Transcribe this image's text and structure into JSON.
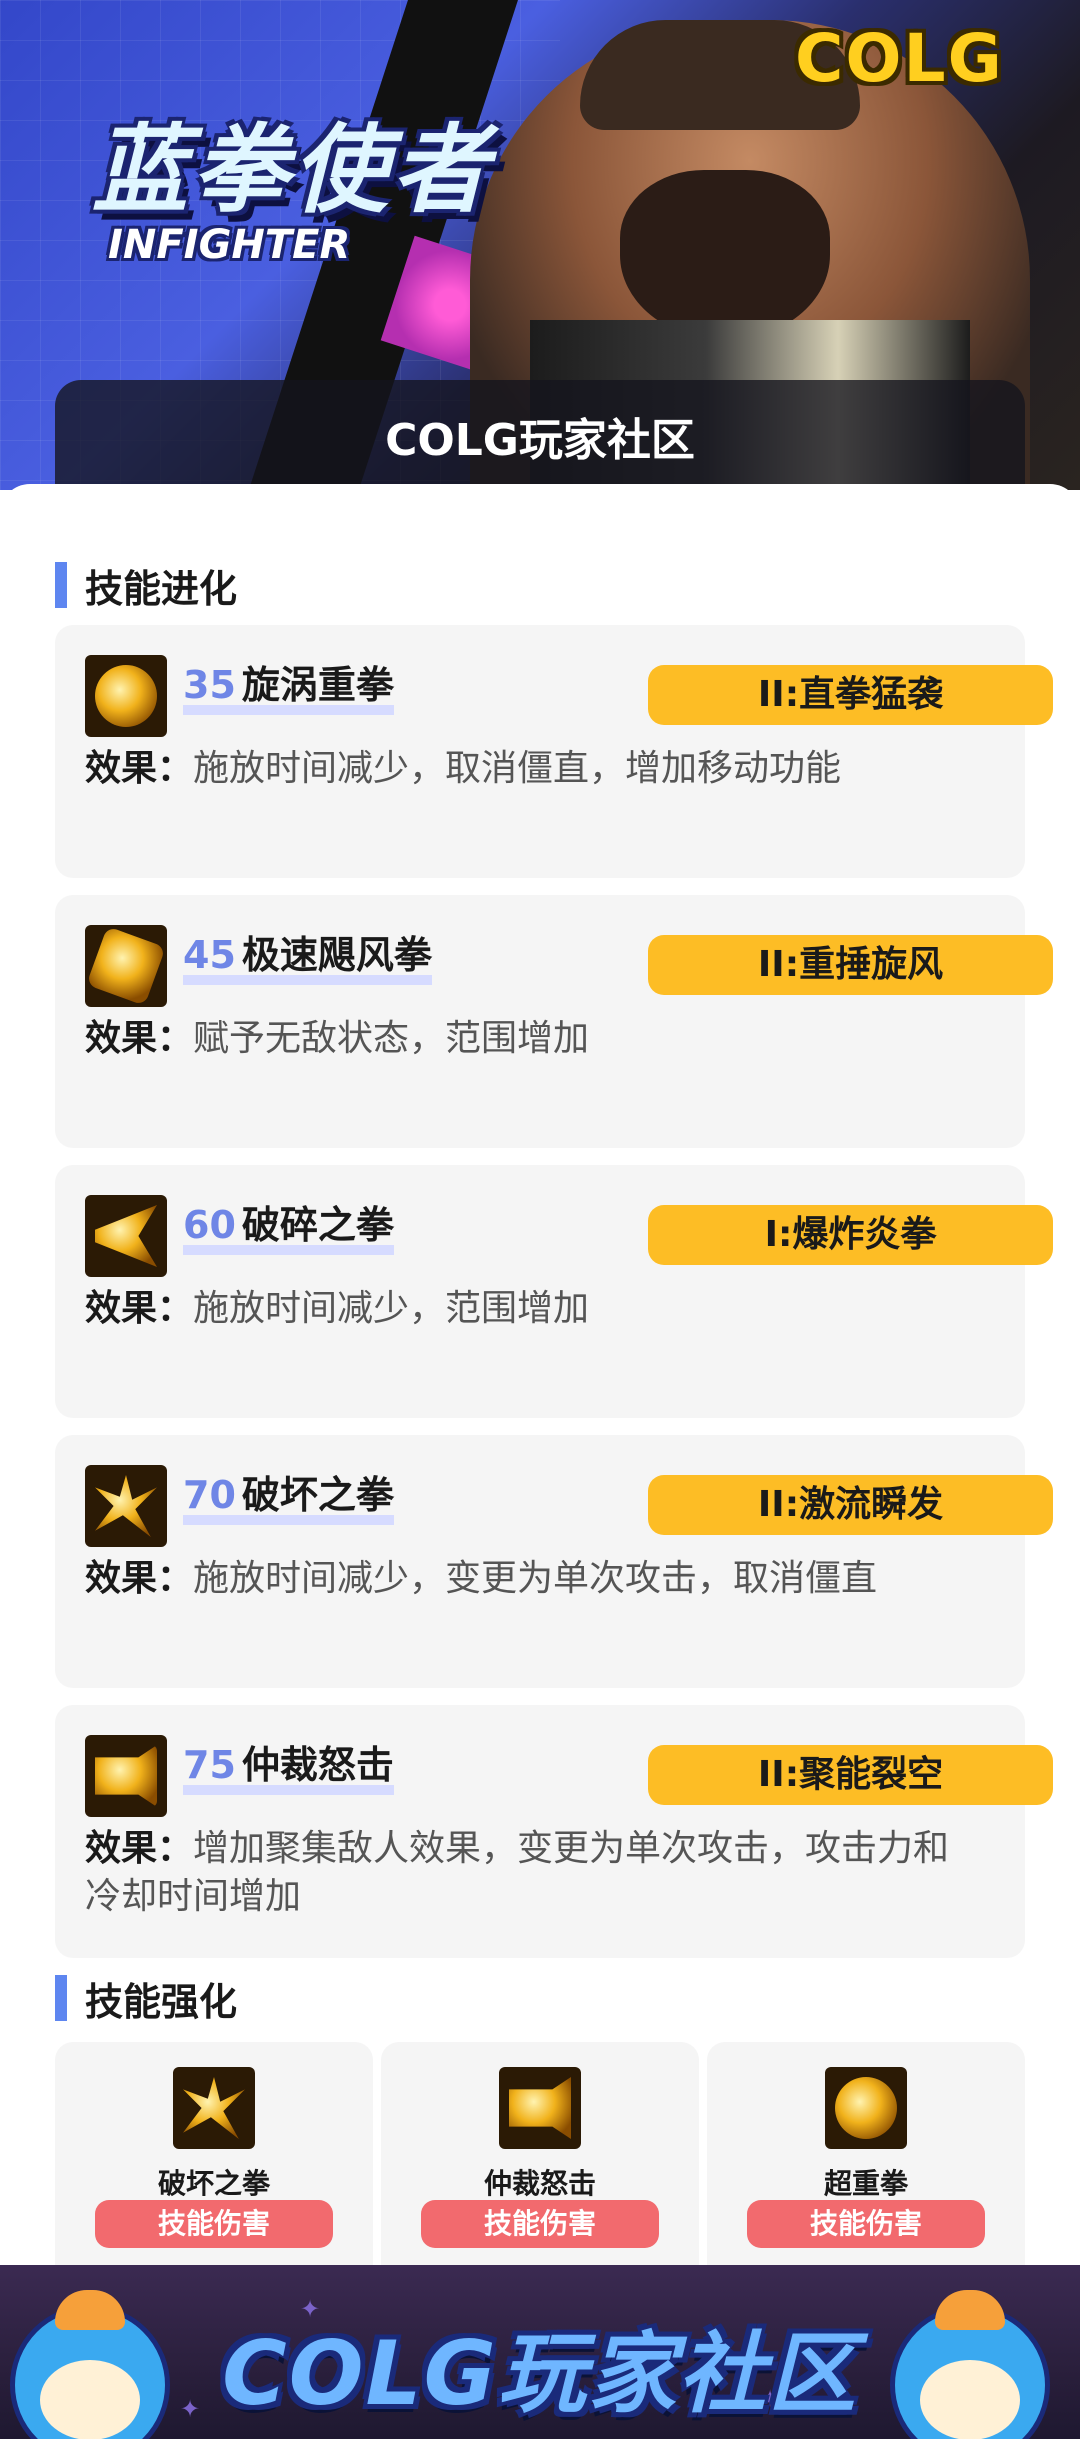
{
  "header": {
    "hero_title": "蓝拳使者",
    "hero_subtitle": "INFIGHTER",
    "brand_logo": "COLG",
    "community_label": "COLG玩家社区"
  },
  "sections": {
    "evolution_title": "技能进化",
    "enhance_title": "技能强化"
  },
  "effect_prefix": "效果：",
  "skills": [
    {
      "level": "35",
      "name": "旋涡重拳",
      "badge": "ⅠⅠ:直拳猛袭",
      "effect": "施放时间减少，取消僵直，增加移动功能",
      "icon": "vortex-punch-icon"
    },
    {
      "level": "45",
      "name": "极速飓风拳",
      "badge": "ⅠⅠ:重捶旋风",
      "effect": "赋予无敌状态，范围增加",
      "icon": "hurricane-punch-icon"
    },
    {
      "level": "60",
      "name": "破碎之拳",
      "badge": "Ⅰ:爆炸炎拳",
      "effect": "施放时间减少，范围增加",
      "icon": "shatter-fist-icon"
    },
    {
      "level": "70",
      "name": "破坏之拳",
      "badge": "ⅠⅠ:激流瞬发",
      "effect": "施放时间减少，变更为单次攻击，取消僵直",
      "icon": "destruction-fist-icon"
    },
    {
      "level": "75",
      "name": "仲裁怒击",
      "badge": "ⅠⅠ:聚能裂空",
      "effect": "增加聚集敌人效果，变更为单次攻击，攻击力和冷却时间增加",
      "icon": "arbitration-strike-icon"
    }
  ],
  "enhancements": [
    {
      "name": "破坏之拳",
      "tag": "技能伤害",
      "icon": "destruction-fist-icon"
    },
    {
      "name": "仲裁怒击",
      "tag": "技能伤害",
      "icon": "arbitration-strike-icon"
    },
    {
      "name": "超重拳",
      "tag": "技能伤害",
      "icon": "super-heavy-punch-icon"
    }
  ],
  "footer": {
    "banner_text": "COLG玩家社区"
  },
  "colors": {
    "accent_blue": "#5e86f0",
    "level_blue": "#6f86e6",
    "badge_yellow": "#fdbd25",
    "tag_red": "#f26a6e",
    "card_bg": "#f5f5f5"
  }
}
